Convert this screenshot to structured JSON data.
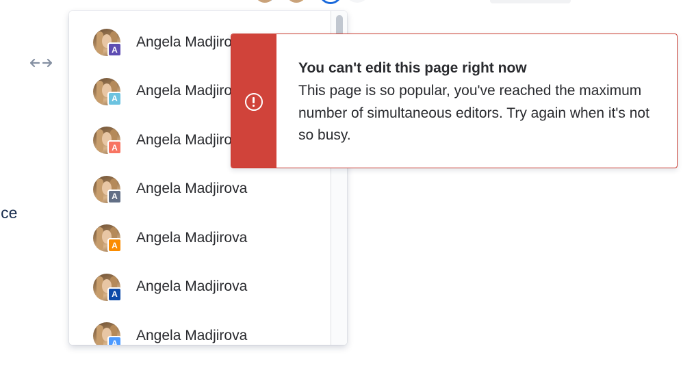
{
  "top_bar": {
    "avatars": [
      {
        "badge_color": "#8590a2"
      },
      {
        "badge_color": "#f5a623"
      }
    ]
  },
  "edge_text": "ice",
  "dropdown": {
    "users": [
      {
        "name": "Angela Madjirova",
        "initial": "A",
        "badge_color": "#5e4db2"
      },
      {
        "name": "Angela Madjirova",
        "initial": "A",
        "badge_color": "#6cc3e0"
      },
      {
        "name": "Angela Madjirova",
        "initial": "A",
        "badge_color": "#f87462"
      },
      {
        "name": "Angela Madjirova",
        "initial": "A",
        "badge_color": "#626f86"
      },
      {
        "name": "Angela Madjirova",
        "initial": "A",
        "badge_color": "#fb8c00"
      },
      {
        "name": "Angela Madjirova",
        "initial": "A",
        "badge_color": "#0c4aa8"
      },
      {
        "name": "Angela Madjirova",
        "initial": "A",
        "badge_color": "#4c9aff"
      }
    ]
  },
  "error_flag": {
    "icon": "error-icon",
    "accent_color": "#d0433a",
    "title": "You can't edit this page right now",
    "body": "This page is so popular, you've reached the maximum number of simultaneous editors. Try again when it's not so busy."
  }
}
